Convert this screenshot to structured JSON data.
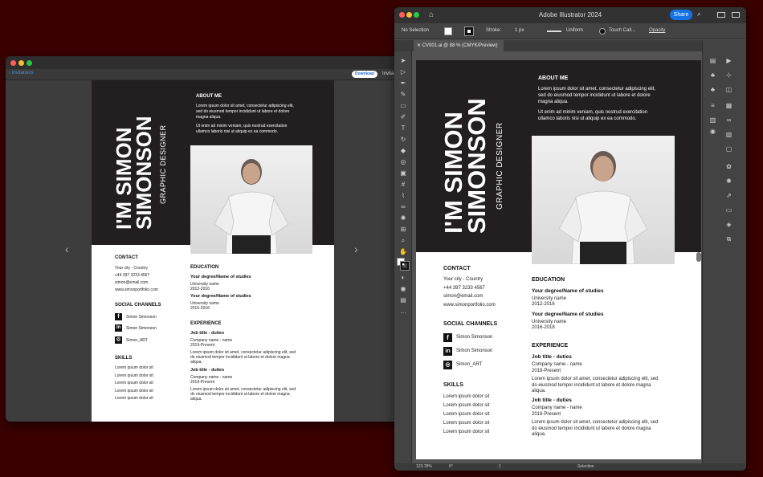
{
  "left_window": {
    "back_label": "Invitations",
    "download_label": "Download",
    "title_partial": "Invita"
  },
  "illustrator": {
    "app_title": "Adobe Illustrator 2024",
    "share_label": "Share",
    "selection_state": "No Selection",
    "stroke_label": "Stroke:",
    "stroke_weight": "1 px",
    "stroke_profile": "Uniform",
    "brush_name": "Touch Call...",
    "opacity_label": "Opacity",
    "document_tab": "CV001.ai @ 88 % (CMYK/Preview)",
    "zoom": "123.78%",
    "rotation": "0°",
    "artboard_number": "1",
    "status_tool": "Selection"
  },
  "cv": {
    "name_line1": "I'M SIMON",
    "name_line2": "SIMONSON",
    "role": "GRAPHIC DESIGNER",
    "about_heading": "ABOUT ME",
    "about_p1_l1": "Lorem ipsum dolor sit amet, consectetur adipiscing elit,",
    "about_p1_l2": "sed do eiusmod tempor incididunt ut labore et dolore",
    "about_p1_l3": "magna aliqua.",
    "about_p2_l1": "Ut enim ad minim veniam, quis nostrud exercitation",
    "about_p2_l2": "ullamco laboris nisi ut aliquip ex ea commodo.",
    "contact_heading": "CONTACT",
    "contact_city": "Your city - Country",
    "contact_phone": "+44 397 3233 4567",
    "contact_email": "simon@email.com",
    "contact_web": "www.simonportfolio.com",
    "social_heading": "SOCIAL CHANNELS",
    "social_facebook": "Simon Simonson",
    "social_linkedin": "Simon Simonson",
    "social_instagram": "Simon_ART",
    "skills_heading": "SKILLS",
    "skill_item": "Lorem ipsum dolor sit",
    "education_heading": "EDUCATION",
    "degree1": "Your degree/Name of studies",
    "uni1": "University name",
    "years1": "2012-2016",
    "degree2": "Your degree/Name of studies",
    "uni2": "University name",
    "years2": "2016-2018",
    "experience_heading": "EXPERIENCE",
    "job1_title": "Job title - duties",
    "job1_company": "Company name -  name",
    "job1_period": "2019-Present",
    "job2_title": "Job title - duties",
    "job2_company": "Company name -  name",
    "job2_period": "2019-Present",
    "job_desc_l1": "Lorem ipsum dolor sit amet, consectetur adipiscing elit, sed",
    "job_desc_l2": "do eiusmod tempor incididunt ut labore et dolore magna",
    "job_desc_l3": "aliqua."
  },
  "colors": {
    "desktop": "#3a0000",
    "cv_band": "#231f20",
    "accent_blue": "#1473e6"
  }
}
